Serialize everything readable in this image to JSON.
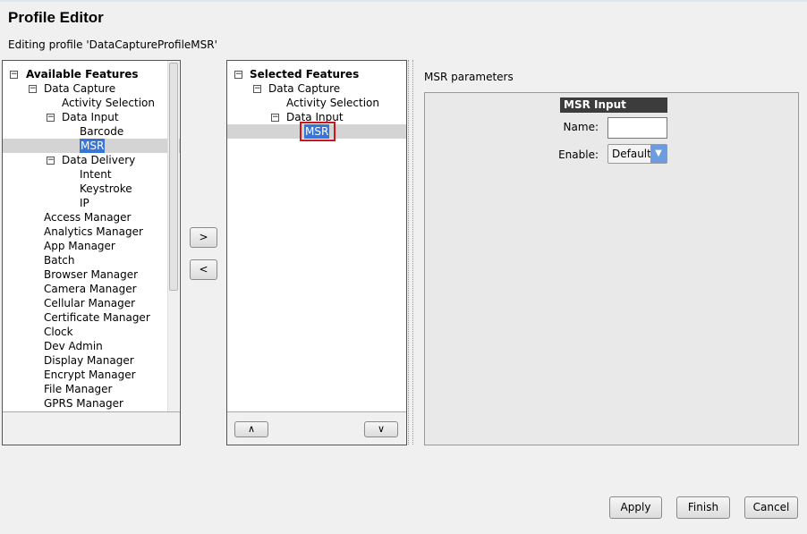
{
  "header": {
    "title": "Profile Editor",
    "subtitle": "Editing profile 'DataCaptureProfileMSR'"
  },
  "available": {
    "root": "Available Features",
    "items": [
      {
        "label": "Data Capture",
        "level": 1,
        "expander": true
      },
      {
        "label": "Activity Selection",
        "level": 2
      },
      {
        "label": "Data Input",
        "level": 2,
        "expander": true
      },
      {
        "label": "Barcode",
        "level": 3
      },
      {
        "label": "MSR",
        "level": 3,
        "selected": true
      },
      {
        "label": "Data Delivery",
        "level": 2,
        "expander": true
      },
      {
        "label": "Intent",
        "level": 3
      },
      {
        "label": "Keystroke",
        "level": 3
      },
      {
        "label": "IP",
        "level": 3
      },
      {
        "label": "Access Manager",
        "level": 1
      },
      {
        "label": "Analytics Manager",
        "level": 1
      },
      {
        "label": "App Manager",
        "level": 1
      },
      {
        "label": "Batch",
        "level": 1
      },
      {
        "label": "Browser Manager",
        "level": 1
      },
      {
        "label": "Camera Manager",
        "level": 1
      },
      {
        "label": "Cellular Manager",
        "level": 1
      },
      {
        "label": "Certificate Manager",
        "level": 1
      },
      {
        "label": "Clock",
        "level": 1
      },
      {
        "label": "Dev Admin",
        "level": 1
      },
      {
        "label": "Display Manager",
        "level": 1
      },
      {
        "label": "Encrypt Manager",
        "level": 1
      },
      {
        "label": "File Manager",
        "level": 1
      },
      {
        "label": "GPRS Manager",
        "level": 1
      }
    ]
  },
  "selected": {
    "root": "Selected Features",
    "items": [
      {
        "label": "Data Capture",
        "level": 1,
        "expander": true
      },
      {
        "label": "Activity Selection",
        "level": 2
      },
      {
        "label": "Data Input",
        "level": 2,
        "expander": true
      },
      {
        "label": "MSR",
        "level": 3,
        "selected": true,
        "highlighted": true
      }
    ]
  },
  "transfer": {
    "add": ">",
    "remove": "<"
  },
  "order": {
    "up": "∧",
    "down": "∨"
  },
  "params": {
    "section": "MSR parameters",
    "group": "MSR Input",
    "name_label": "Name:",
    "name_value": "",
    "enable_label": "Enable:",
    "enable_value": "Default"
  },
  "footer": {
    "apply": "Apply",
    "finish": "Finish",
    "cancel": "Cancel"
  }
}
